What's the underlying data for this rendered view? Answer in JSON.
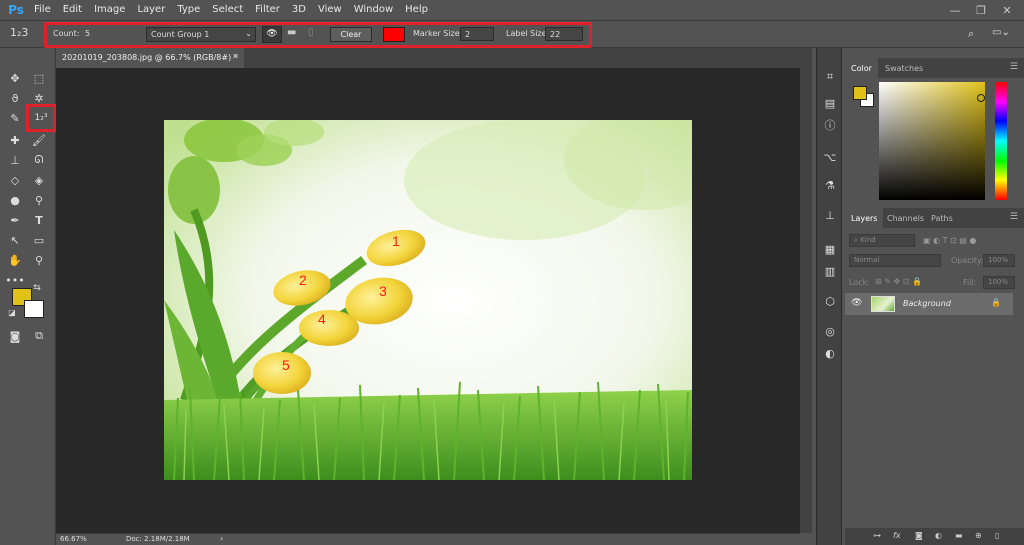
{
  "app": {
    "logo": "Ps"
  },
  "menu": [
    "File",
    "Edit",
    "Image",
    "Layer",
    "Type",
    "Select",
    "Filter",
    "3D",
    "View",
    "Window",
    "Help"
  ],
  "window_controls": [
    "—",
    "❐",
    "✕"
  ],
  "options": {
    "tool_glyph": "1₂3",
    "count_label": "Count:",
    "count_value": "5",
    "group_value": "Count Group 1",
    "clear_label": "Clear",
    "marker_color": "#ff0000",
    "marker_size_label": "Marker Size:",
    "marker_size_value": "2",
    "label_size_label": "Label Size:",
    "label_size_value": "22"
  },
  "document": {
    "tab_title": "20201019_203808.jpg @ 66.7% (RGB/8#) *",
    "markers": [
      {
        "label": "1"
      },
      {
        "label": "2"
      },
      {
        "label": "3"
      },
      {
        "label": "4"
      },
      {
        "label": "5"
      }
    ]
  },
  "status": {
    "zoom": "66.67%",
    "doc_size": "Doc: 2.18M/2.18M",
    "arrow": "›"
  },
  "colors": {
    "foreground": "#e0c219",
    "background": "#ffffff",
    "highlight": "#e0202a"
  },
  "color_panel": {
    "tabs": [
      "Color",
      "Swatches"
    ]
  },
  "layers_panel": {
    "tabs": [
      "Layers",
      "Channels",
      "Paths"
    ],
    "kind_placeholder": "Kind",
    "blend_mode": "Normal",
    "opacity_label": "Opacity:",
    "opacity_value": "100%",
    "lock_label": "Lock:",
    "fill_label": "Fill:",
    "fill_value": "100%",
    "layers": [
      {
        "name": "Background"
      }
    ]
  }
}
